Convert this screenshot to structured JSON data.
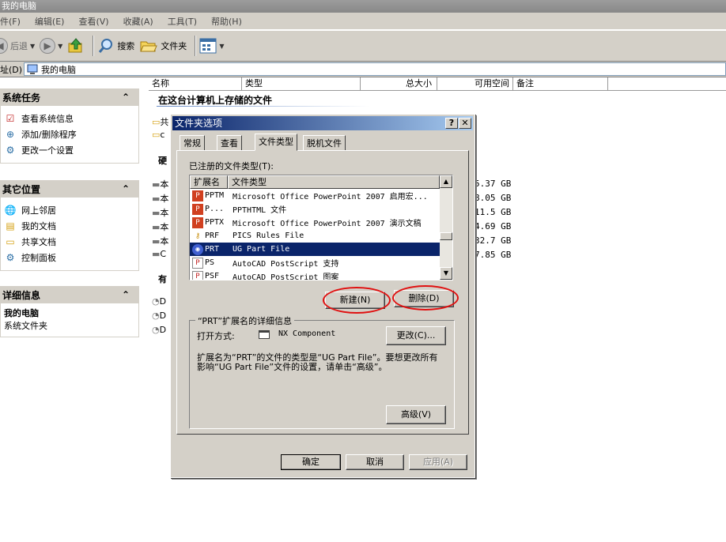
{
  "window": {
    "title": "我的电脑"
  },
  "menu": [
    "件(F)",
    "编辑(E)",
    "查看(V)",
    "收藏(A)",
    "工具(T)",
    "帮助(H)"
  ],
  "toolbar": {
    "back_label": "后退",
    "search_label": "搜索",
    "folders_label": "文件夹"
  },
  "address": {
    "label": "址(D)",
    "value": "我的电脑"
  },
  "left_pane": {
    "system_tasks": {
      "title": "系统任务",
      "items": [
        "查看系统信息",
        "添加/删除程序",
        "更改一个设置"
      ]
    },
    "other_places": {
      "title": "其它位置",
      "items": [
        "网上邻居",
        "我的文档",
        "共享文档",
        "控制面板"
      ]
    },
    "details": {
      "title": "详细信息",
      "name": "我的电脑",
      "desc": "系统文件夹"
    },
    "collapse_glyph": "⌃"
  },
  "content": {
    "columns": [
      "名称",
      "类型",
      "总大小",
      "可用空间",
      "备注"
    ],
    "group_title": "在这台计算机上存储的文件",
    "bg_labels": [
      "共",
      "c",
      "硬",
      "本",
      "本",
      "本",
      "本",
      "本",
      "C",
      "有",
      "D",
      "D",
      "D"
    ],
    "bg_sizes": [
      "5.37 GB",
      "8.05 GB",
      "11.5 GB",
      "4.69 GB",
      "32.7 GB",
      "7.85 GB"
    ]
  },
  "dialog": {
    "title": "文件夹选项",
    "help_glyph": "?",
    "close_glyph": "✕",
    "tabs": [
      "常规",
      "查看",
      "文件类型",
      "脱机文件"
    ],
    "registered_label": "已注册的文件类型(T):",
    "list_headers": [
      "扩展名",
      "文件类型"
    ],
    "rows": [
      {
        "ext": "PPTM",
        "type": "Microsoft Office PowerPoint 2007 启用宏..."
      },
      {
        "ext": "P...",
        "type": "PPTHTML 文件"
      },
      {
        "ext": "PPTX",
        "type": "Microsoft Office PowerPoint 2007 演示文稿"
      },
      {
        "ext": "PRF",
        "type": "PICS Rules File"
      },
      {
        "ext": "PRT",
        "type": "UG Part File"
      },
      {
        "ext": "PS",
        "type": "AutoCAD PostScript 支持"
      },
      {
        "ext": "PSF",
        "type": "AutoCAD PostScript 图案"
      }
    ],
    "new_button": "新建(N)",
    "delete_button": "删除(D)",
    "details_legend": "“PRT”扩展名的详细信息",
    "opens_with_label": "打开方式:",
    "opens_with_value": "NX Component",
    "change_button": "更改(C)...",
    "details_text": "扩展名为“PRT”的文件的类型是“UG Part File”。要想更改所有影响“UG Part File”文件的设置，请单击“高级”。",
    "advanced_button": "高级(V)",
    "ok_button": "确定",
    "cancel_button": "取消",
    "apply_button": "应用(A)"
  }
}
